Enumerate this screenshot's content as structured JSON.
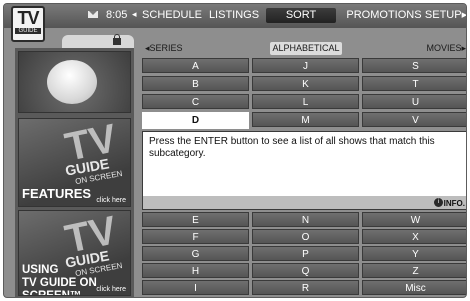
{
  "app": {
    "logo_big": "TV",
    "logo_small": "GUIDE"
  },
  "topbar": {
    "time": "8:05",
    "nav_arrow": "◂",
    "tabs": [
      {
        "label": "SCHEDULE",
        "active": false
      },
      {
        "label": "LISTINGS",
        "active": false
      },
      {
        "label": "SORT",
        "active": true
      },
      {
        "label": "PROMOTIONS",
        "active": false
      },
      {
        "label": "SETUP▸",
        "active": false
      }
    ]
  },
  "left_panel": {
    "features": {
      "tv": "TV",
      "guide": "GUIDE",
      "on_screen": "ON SCREEN",
      "title": "FEATURES",
      "link": "click here"
    },
    "using": {
      "tv": "TV",
      "guide": "GUIDE",
      "on_screen": "ON SCREEN",
      "title_line1": "USING",
      "title_line2": "TV GUIDE ON SCREEN™",
      "link": "click here"
    }
  },
  "sort": {
    "left": "◂SERIES",
    "center": "ALPHABETICAL",
    "right": "MOVIES▸",
    "rows_top": [
      [
        "A",
        "J",
        "S"
      ],
      [
        "B",
        "K",
        "T"
      ],
      [
        "C",
        "L",
        "U"
      ],
      [
        "D",
        "M",
        "V"
      ]
    ],
    "rows_bottom": [
      [
        "E",
        "N",
        "W"
      ],
      [
        "F",
        "O",
        "X"
      ],
      [
        "G",
        "P",
        "Y"
      ],
      [
        "H",
        "Q",
        "Z"
      ],
      [
        "I",
        "R",
        "Misc"
      ]
    ],
    "selected": "D"
  },
  "info": {
    "text": "Press the ENTER button to see a list of all shows that match this subcategory.",
    "icon": "i",
    "label": "INFO."
  },
  "colors": {
    "screen_bg": "#8e8e8e",
    "cell_bg": "#606060",
    "selected_bg": "#ffffff",
    "topbar_bg": "#555555"
  }
}
